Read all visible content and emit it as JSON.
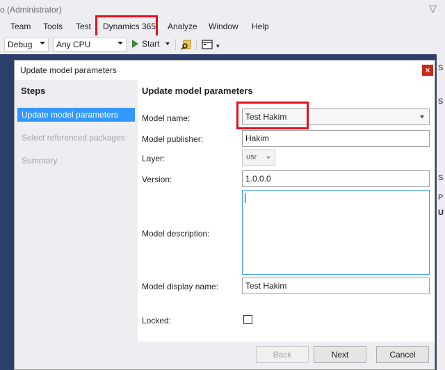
{
  "window": {
    "title": "o (Administrator)"
  },
  "menu": {
    "items": [
      "Team",
      "Tools",
      "Test",
      "Dynamics 365",
      "Analyze",
      "Window",
      "Help"
    ],
    "highlighted": "Dynamics 365"
  },
  "toolbar": {
    "configuration": "Debug",
    "platform": "Any CPU",
    "start_label": "Start"
  },
  "right_strip": {
    "cells": [
      "S",
      "S",
      "S",
      "P",
      "U"
    ]
  },
  "dialog": {
    "title": "Update model parameters",
    "close_glyph": "×",
    "steps_title": "Steps",
    "steps": [
      {
        "label": "Update model parameters",
        "active": true
      },
      {
        "label": "Select referenced packages",
        "active": false
      },
      {
        "label": "Summary",
        "active": false
      }
    ],
    "heading": "Update model parameters",
    "fields": {
      "model_name": {
        "label": "Model name:",
        "value": "Test Hakim"
      },
      "model_publisher": {
        "label": "Model publisher:",
        "value": "Hakim"
      },
      "layer": {
        "label": "Layer:",
        "value": "usr"
      },
      "version": {
        "label": "Version:",
        "value": "1.0.0.0"
      },
      "model_description": {
        "label": "Model description:",
        "value": ""
      },
      "model_display_name": {
        "label": "Model display name:",
        "value": "Test Hakim"
      },
      "locked": {
        "label": "Locked:",
        "checked": false
      }
    },
    "buttons": {
      "back": "Back",
      "next": "Next",
      "cancel": "Cancel"
    }
  },
  "colors": {
    "accent": "#3399ff",
    "highlight_box": "#e0101a",
    "ide_background": "#2c3e6a"
  }
}
